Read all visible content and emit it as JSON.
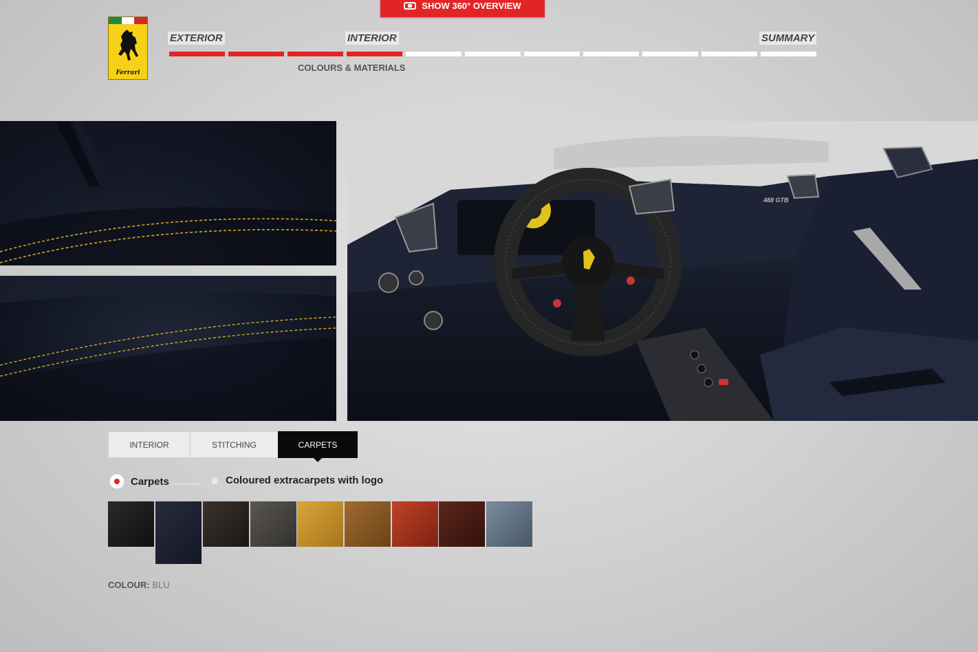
{
  "header": {
    "overview_button": "SHOW 360° OVERVIEW",
    "logo_text": "Ferrari"
  },
  "steps": {
    "labels": [
      "EXTERIOR",
      "INTERIOR",
      "SUMMARY"
    ],
    "sub_label": "COLOURS & MATERIALS",
    "progress_completed": 4,
    "progress_total": 11
  },
  "tabs": [
    {
      "label": "INTERIOR",
      "active": false
    },
    {
      "label": "STITCHING",
      "active": false
    },
    {
      "label": "CARPETS",
      "active": true
    }
  ],
  "options": [
    {
      "label": "Carpets",
      "selected": true
    },
    {
      "label": "Coloured extracarpets with logo",
      "selected": false
    }
  ],
  "swatches": [
    {
      "name": "black",
      "color": "#1b1b1d",
      "selected": false
    },
    {
      "name": "blu",
      "color": "#1d2130",
      "selected": true
    },
    {
      "name": "dark-brown",
      "color": "#2a2420",
      "selected": false
    },
    {
      "name": "grey",
      "color": "#4a4743",
      "selected": false
    },
    {
      "name": "yellow",
      "color": "#c9932a",
      "selected": false
    },
    {
      "name": "tan",
      "color": "#8a5a25",
      "selected": false
    },
    {
      "name": "red",
      "color": "#a1311c",
      "selected": false
    },
    {
      "name": "burgundy",
      "color": "#4a1d14",
      "selected": false
    },
    {
      "name": "light-blue",
      "color": "#5f7182",
      "selected": false
    }
  ],
  "colour": {
    "label": "COLOUR:",
    "value": "BLU"
  },
  "colors": {
    "accent": "#e32426",
    "stitching": "#d6a821"
  },
  "interior_image": {
    "badge_text": "488 GTB"
  }
}
